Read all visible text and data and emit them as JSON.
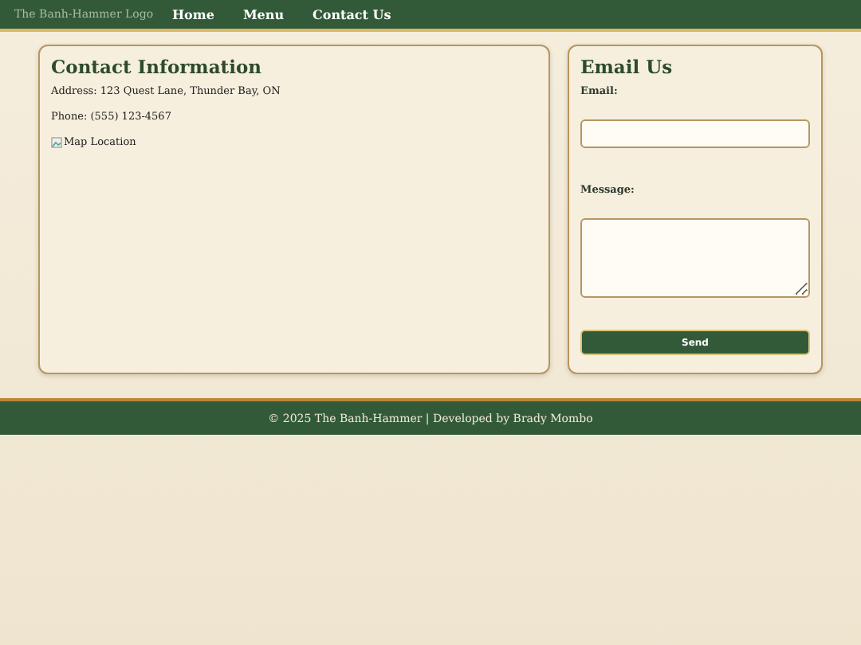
{
  "header": {
    "logo_alt": "The Banh-Hammer Logo",
    "nav": [
      {
        "label": "Home"
      },
      {
        "label": "Menu"
      },
      {
        "label": "Contact Us"
      }
    ]
  },
  "contact": {
    "title": "Contact Information",
    "address": "Address: 123 Quest Lane, Thunder Bay, ON",
    "phone": "Phone: (555) 123-4567",
    "map_alt": "Map Location"
  },
  "email_form": {
    "title": "Email Us",
    "email_label": "Email:",
    "message_label": "Message:",
    "button": "Send"
  },
  "footer": {
    "text": "© 2025 The Banh-Hammer | Developed by Brady Mombo"
  }
}
